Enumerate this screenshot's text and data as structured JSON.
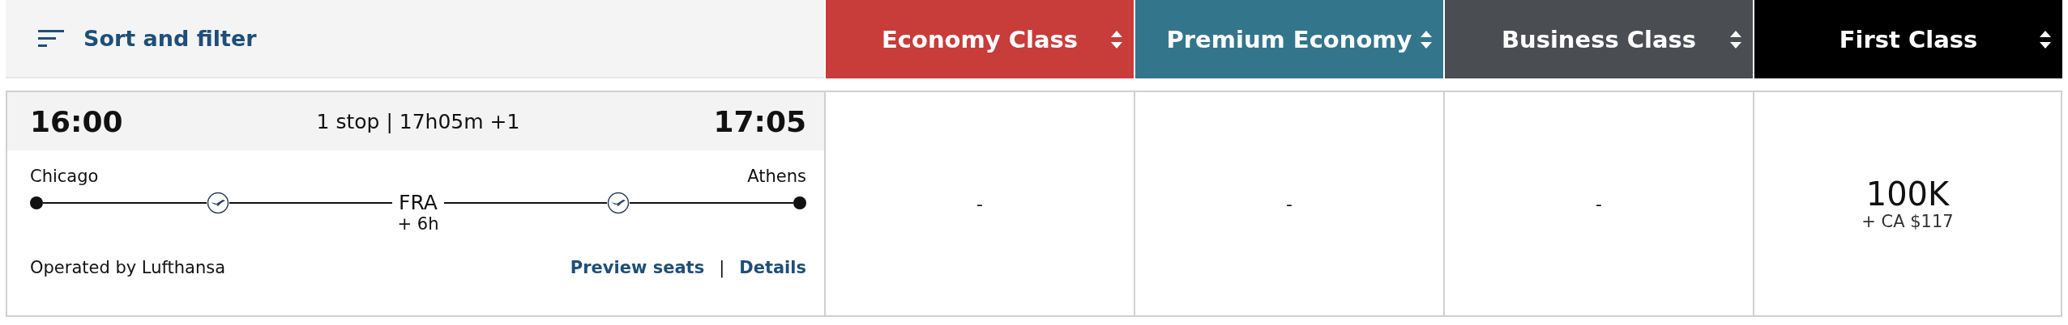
{
  "sort_filter": {
    "label": "Sort and filter"
  },
  "cabin_columns": [
    {
      "label": "Economy Class",
      "color": "#c83c3a"
    },
    {
      "label": "Premium Economy",
      "color": "#33768c"
    },
    {
      "label": "Business Class",
      "color": "#4a4d51"
    },
    {
      "label": "First Class",
      "color": "#000000"
    }
  ],
  "flight": {
    "departure_time": "16:00",
    "summary": "1 stop | 17h05m +1",
    "arrival_time": "17:05",
    "origin": "Chicago",
    "destination": "Athens",
    "stop": {
      "code": "FRA",
      "layover": "+ 6h"
    },
    "operator": "Operated by Lufthansa",
    "links": [
      "Preview seats",
      "Details"
    ],
    "link_separator": "|"
  },
  "fares": [
    {
      "kind": "none",
      "text": "-"
    },
    {
      "kind": "none",
      "text": "-"
    },
    {
      "kind": "none",
      "text": "-"
    },
    {
      "kind": "price",
      "points": "100K",
      "taxes": "+ CA $117"
    }
  ]
}
